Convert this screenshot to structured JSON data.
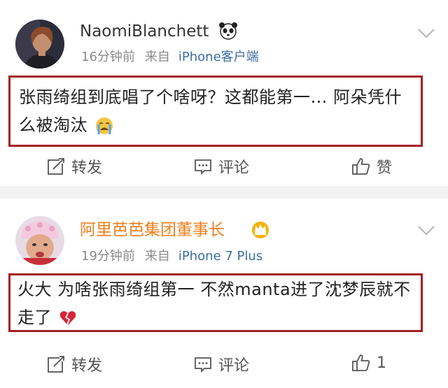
{
  "posts": [
    {
      "username": "NaomiBlanchett",
      "badge_icon": "panda-icon",
      "time": "16分钟前",
      "from_label": "来自",
      "source": "iPhone客户端",
      "content": "张雨绮组到底唱了个啥呀？这都能第一… 阿朵凭什么被淘汰",
      "content_emoji": "crying-face-icon",
      "actions": {
        "forward": "转发",
        "comment": "评论",
        "like": "赞"
      }
    },
    {
      "username": "阿里芭芭集团董事长",
      "badge_icon": "crown-icon",
      "time": "19分钟前",
      "from_label": "来自",
      "source": "iPhone 7 Plus",
      "content": "火大 为啥张雨绮组第一 不然manta进了沈梦辰就不走了",
      "content_emoji": "broken-heart-icon",
      "actions": {
        "forward": "转发",
        "comment": "评论",
        "like": "1"
      }
    }
  ],
  "colors": {
    "highlight_border": "#a31f25",
    "vip_name": "#ef7f1a",
    "source_link": "#3b6ea5"
  }
}
